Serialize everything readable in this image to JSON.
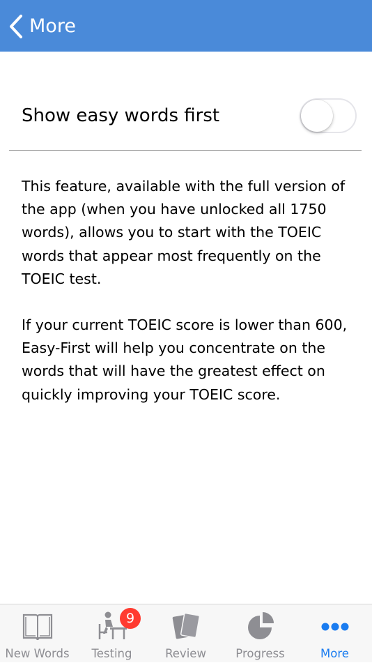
{
  "navbar": {
    "back_label": "More",
    "color": "#4a8ad9"
  },
  "setting": {
    "label": "Show easy words first",
    "toggle_on": false
  },
  "description": {
    "paragraph1": "This feature, available with the full version of the app (when you have unlocked all 1750 words), allows you to start with the TOEIC words that appear most frequently on the TOEIC test.",
    "paragraph2": "If your current TOEIC score is lower than 600, Easy-First will help you concentrate on the words that will have the greatest effect on quickly improving your TOEIC score."
  },
  "tabbar": {
    "tabs": [
      {
        "label": "New Words",
        "icon": "book-icon"
      },
      {
        "label": "Testing",
        "icon": "student-desk-icon",
        "badge": "9"
      },
      {
        "label": "Review",
        "icon": "cards-icon"
      },
      {
        "label": "Progress",
        "icon": "pie-chart-icon"
      },
      {
        "label": "More",
        "icon": "more-dots-icon",
        "active": true
      }
    ],
    "active_color": "#1a7cf0",
    "inactive_color": "#8e8e93"
  }
}
